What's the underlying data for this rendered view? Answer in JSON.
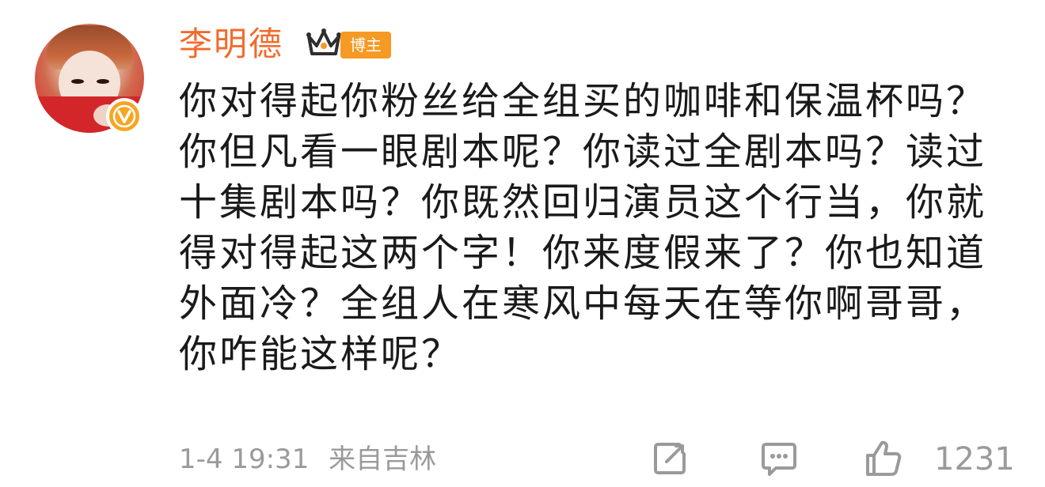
{
  "author": {
    "name": "李明德",
    "badge_label": "博主",
    "avatar_icon": "user-avatar",
    "verified_icon": "verified-v-icon",
    "crown_icon": "crown-icon"
  },
  "comment": {
    "text": "你对得起你粉丝给全组买的咖啡和保温杯吗？你但凡看一眼剧本呢？你读过全剧本吗？读过十集剧本吗？你既然回归演员这个行当，你就得对得起这两个字！你来度假来了？你也知道外面冷？全组人在寒风中每天在等你啊哥哥，你咋能这样呢？"
  },
  "meta": {
    "time": "1-4 19:31",
    "source": "来自吉林"
  },
  "actions": {
    "share_icon": "share-edit-icon",
    "reply_icon": "reply-comment-icon",
    "like_icon": "like-thumb-icon",
    "like_count": "1231"
  },
  "colors": {
    "username": "#f26b2c",
    "badge": "#f59a24",
    "verified": "#f5a623",
    "meta": "#9a9a9a",
    "body_text": "#1a1a1a"
  }
}
